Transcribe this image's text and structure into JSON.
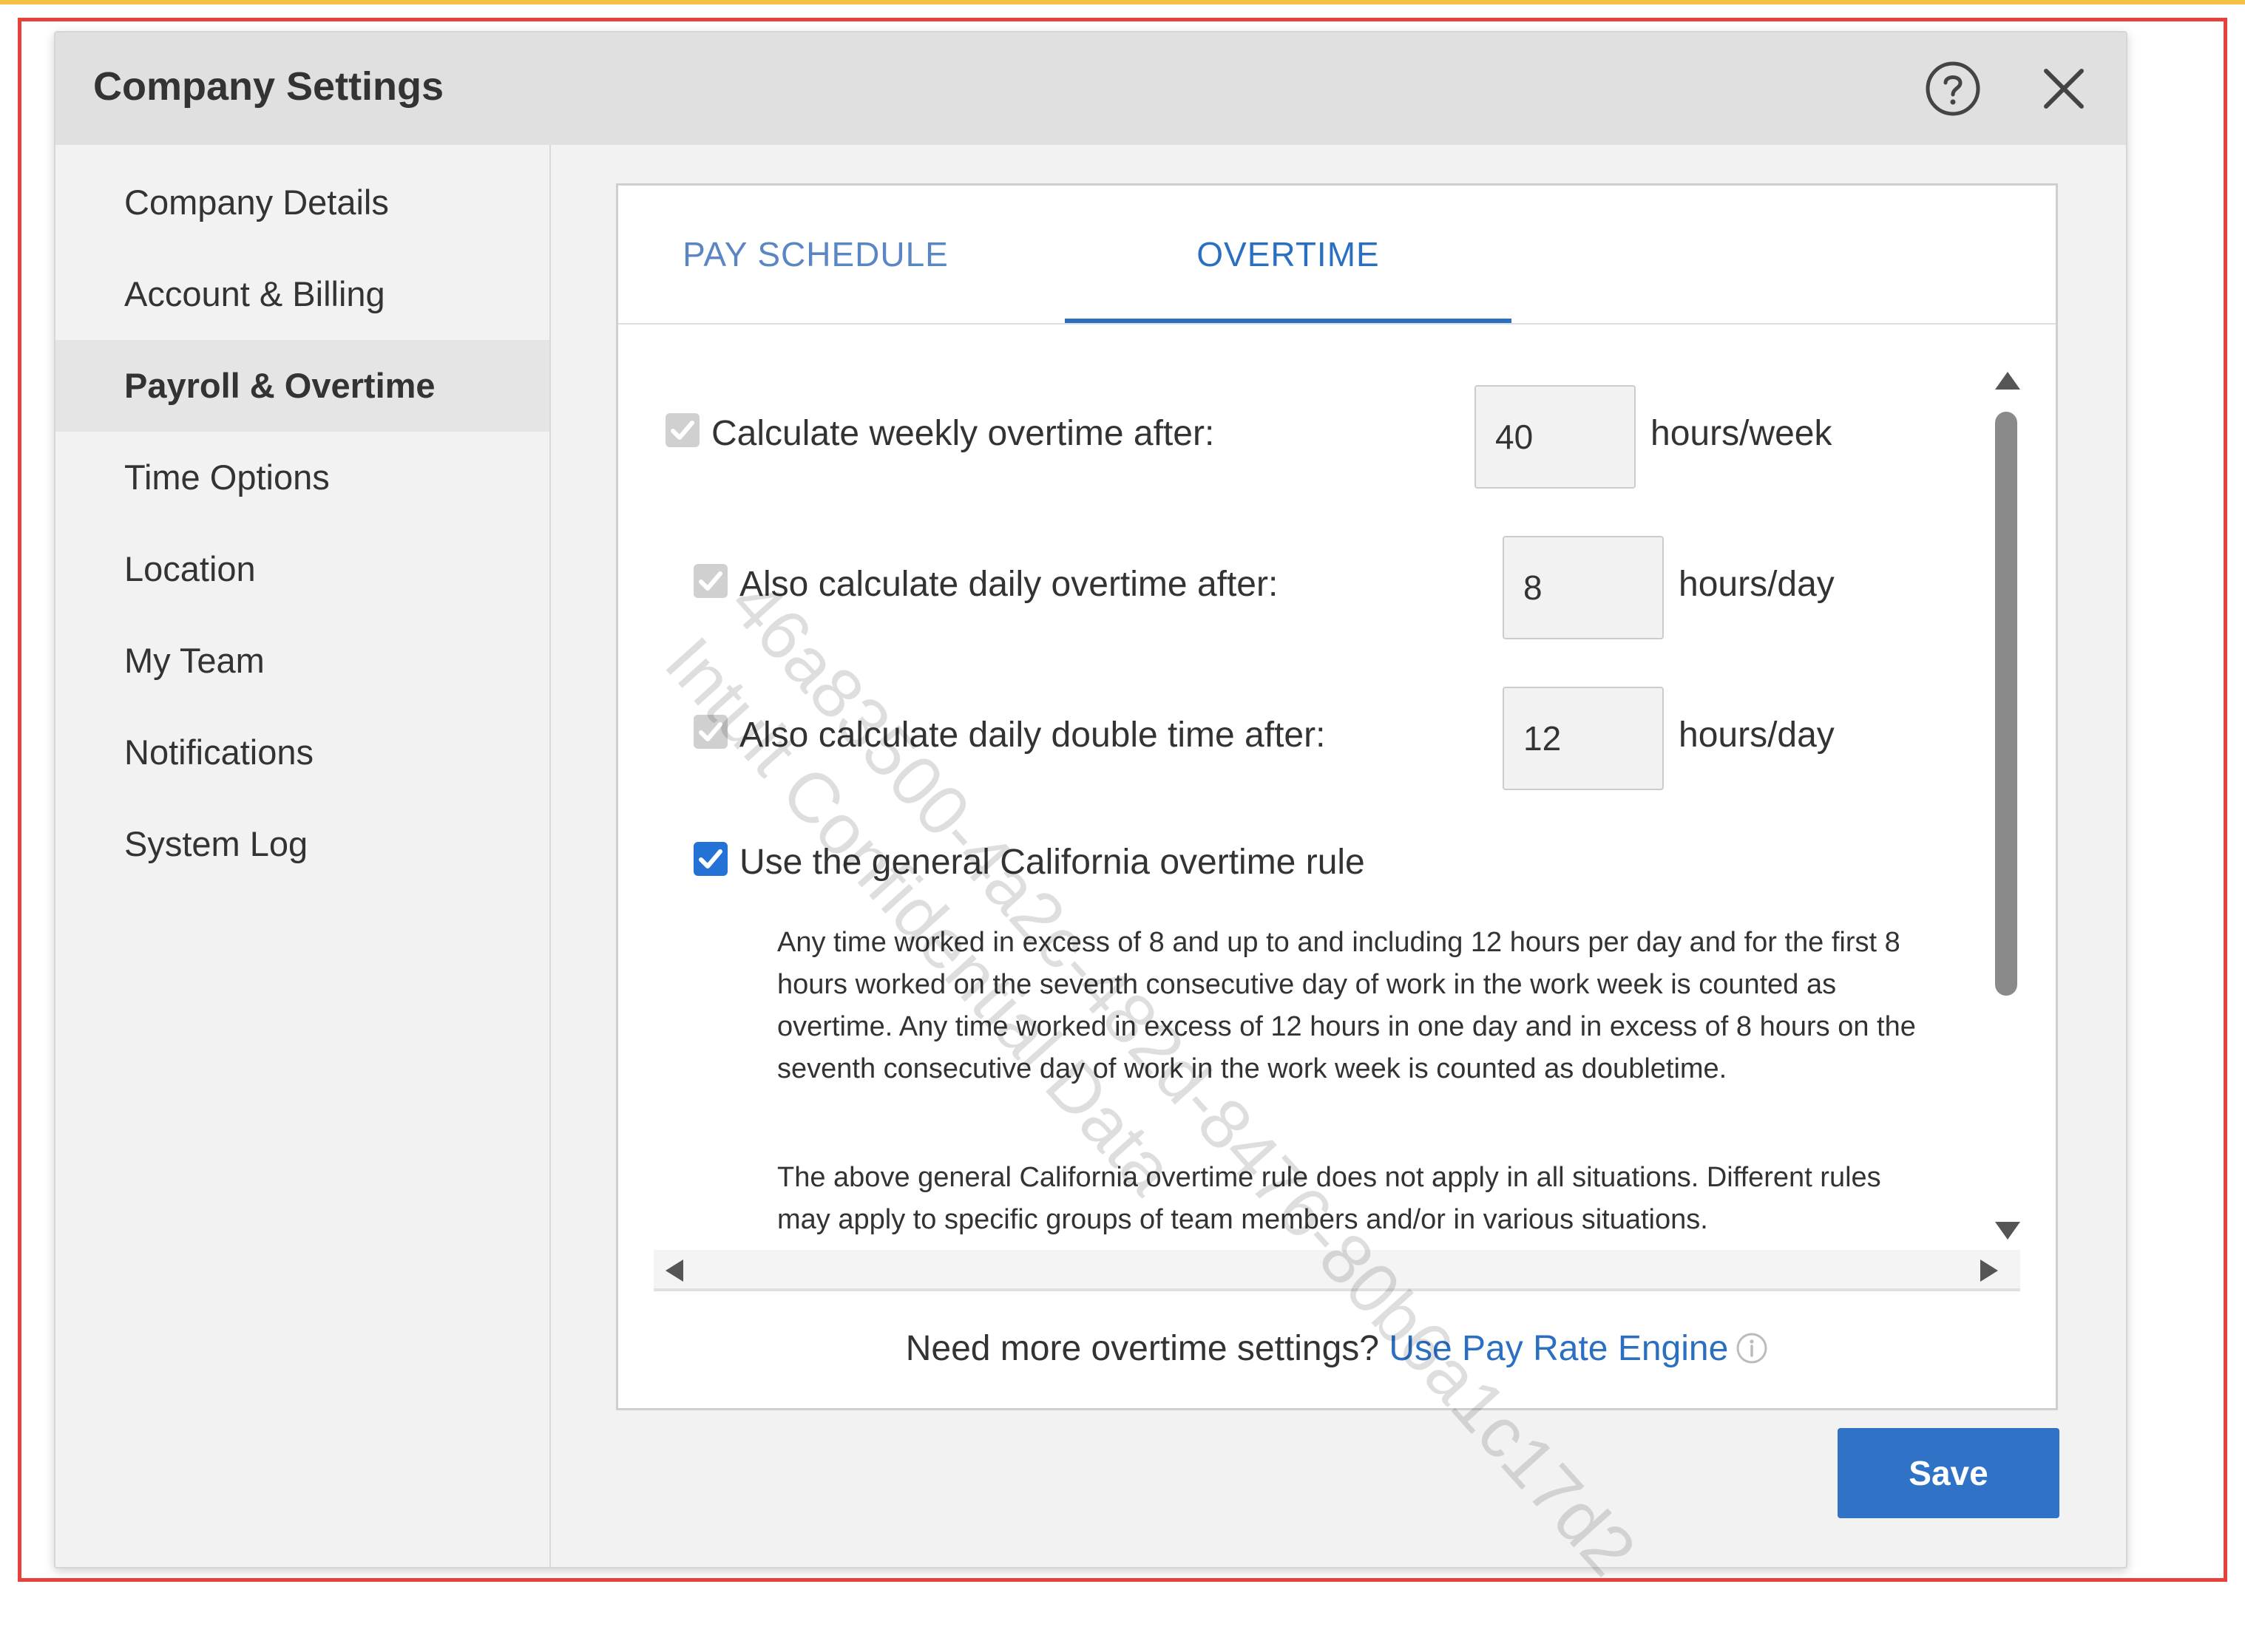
{
  "dialog": {
    "title": "Company Settings",
    "help_icon": "help-circle-icon",
    "close_icon": "close-icon"
  },
  "sidebar": {
    "items": [
      {
        "label": "Company Details"
      },
      {
        "label": "Account & Billing"
      },
      {
        "label": "Payroll & Overtime",
        "active": true
      },
      {
        "label": "Time Options"
      },
      {
        "label": "Location"
      },
      {
        "label": "My Team"
      },
      {
        "label": "Notifications"
      },
      {
        "label": "System Log"
      }
    ]
  },
  "tabs": [
    {
      "label": "PAY SCHEDULE"
    },
    {
      "label": "OVERTIME",
      "active": true
    }
  ],
  "overtime": {
    "weekly": {
      "label": "Calculate weekly overtime after:",
      "value": "40",
      "unit": "hours/week",
      "checked": true,
      "disabled": true
    },
    "daily": {
      "label": "Also calculate daily overtime after:",
      "value": "8",
      "unit": "hours/day",
      "checked": true,
      "disabled": true
    },
    "double": {
      "label": "Also calculate daily double time after:",
      "value": "12",
      "unit": "hours/day",
      "checked": true,
      "disabled": true
    },
    "california": {
      "label": "Use the general California overtime rule",
      "checked": true,
      "desc1": "Any time worked in excess of 8 and up to and including 12 hours per day and for the first 8 hours worked on the seventh consecutive day of work in the work week is counted as overtime. Any time worked in excess of 12 hours in one day and in excess of 8 hours on the seventh consecutive day of work in the work week is counted as doubletime.",
      "desc2": "The above general California overtime rule does not apply in all situations. Different rules may apply to specific groups of team members and/or in various situations."
    }
  },
  "footer": {
    "prompt": "Need more overtime settings?",
    "link": "Use Pay Rate Engine",
    "info_icon": "info-icon"
  },
  "save_label": "Save",
  "watermark": {
    "line1": "46a83500-4a2c-482d-8476-80b6a1c17d2",
    "line2": "Intuit Confidential Data"
  },
  "colors": {
    "accent": "#2b6fc1",
    "save_button": "#2f72c6",
    "frame": "#e8413c",
    "top_accent": "#f5c043"
  }
}
